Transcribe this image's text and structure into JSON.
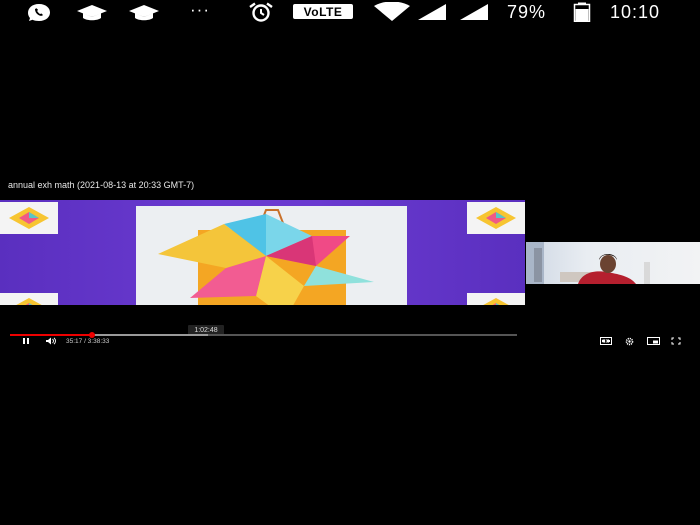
{
  "status_bar": {
    "icons": [
      "whatsapp-icon",
      "graduation-cap-icon",
      "graduation-cap-icon",
      "more-dots-icon",
      "alarm-icon",
      "wifi-icon",
      "signal-icon",
      "signal-icon",
      "battery-icon"
    ],
    "volte": "VoLTE",
    "more": "···",
    "battery_percent": "79%",
    "time": "10:10"
  },
  "video": {
    "title": "annual exh math (2021-08-13 at 20:33 GMT-7)",
    "hover_time": "1:02:48",
    "time_display": "35:17 / 3:38:33",
    "progress_fraction": 0.161,
    "buffered_fraction": 0.39,
    "colors": {
      "accent": "#ee0000",
      "frame_bg": "#6a3ad0"
    }
  },
  "player_icons": [
    "pause-icon",
    "volume-icon",
    "captions-icon",
    "settings-icon",
    "miniplayer-icon",
    "fullscreen-icon"
  ]
}
